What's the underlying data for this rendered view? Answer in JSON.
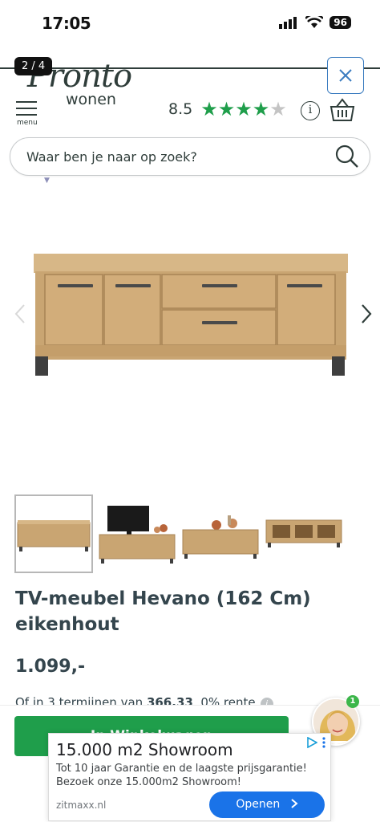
{
  "status_bar": {
    "time": "17:05",
    "battery": "96"
  },
  "gallery": {
    "counter": "2 / 4"
  },
  "header": {
    "logo_title": "Pronto",
    "logo_subtitle": "wonen",
    "menu_label": "menu",
    "rating_score": "8.5",
    "rating_stars": 4,
    "rating_max": 5,
    "info_icon": "i"
  },
  "search": {
    "placeholder": "Waar ben je naar op zoek?"
  },
  "product": {
    "title": "TV-meubel Hevano (162 Cm) eikenhout",
    "price": "1.099,-",
    "installment_prefix": "Of in 3 termijnen van ",
    "installment_amount": "366,33",
    "installment_suffix": ", 0% rente",
    "add_to_cart": "In Winkelwagen"
  },
  "chat": {
    "badge": "1"
  },
  "ad": {
    "title": "15.000 m2 Showroom",
    "description": "Tot 10 jaar Garantie en de laagste prijsgarantie! Bezoek onze 15.000m2 Showroom!",
    "domain": "zitmaxx.nl",
    "button_label": "Openen"
  },
  "colors": {
    "brand_dark": "#2f3d3a",
    "star_green": "#1f9e4b",
    "cta_green": "#1f9e4b",
    "ad_blue": "#1a73e8",
    "close_blue": "#3b7cc0"
  },
  "icons": [
    "menu-icon",
    "star-icon",
    "info-icon",
    "basket-icon",
    "search-icon",
    "close-icon",
    "chevron-left-icon",
    "chevron-right-icon",
    "ad-choices-icon",
    "chevron-right-icon"
  ]
}
